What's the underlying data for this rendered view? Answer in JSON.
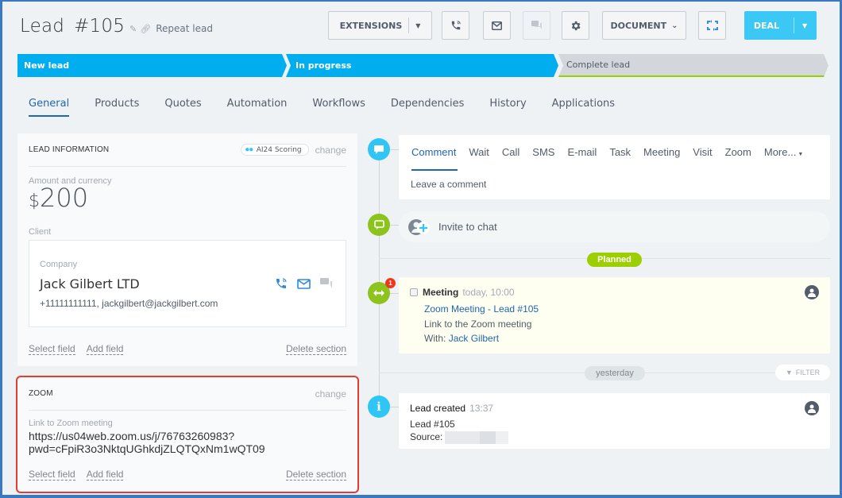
{
  "header": {
    "title": "Lead",
    "number": "#105",
    "repeat_lead": "Repeat lead"
  },
  "toolbar": {
    "extensions_label": "EXTENSIONS",
    "document_label": "DOCUMENT",
    "deal_label": "DEAL"
  },
  "stages": [
    {
      "label": "New lead",
      "state": "active"
    },
    {
      "label": "In progress",
      "state": "active"
    },
    {
      "label": "Complete lead",
      "state": "inactive"
    }
  ],
  "tabs": [
    "General",
    "Products",
    "Quotes",
    "Automation",
    "Workflows",
    "Dependencies",
    "History",
    "Applications"
  ],
  "lead_info": {
    "title": "LEAD INFORMATION",
    "scoring_label": "AI24 Scoring",
    "change_label": "change",
    "amount_label": "Amount and currency",
    "currency_symbol": "$",
    "amount": "200",
    "client_label": "Client",
    "company_label": "Company",
    "company_name": "Jack Gilbert LTD",
    "company_contact": "+11111111111, jackgilbert@jackgilbert.com",
    "select_field": "Select field",
    "add_field": "Add field",
    "delete_section": "Delete section"
  },
  "zoom_section": {
    "title": "ZOOM",
    "change_label": "change",
    "link_label": "Link to Zoom meeting",
    "link_line1": "https://us04web.zoom.us/j/76763260983?",
    "link_line2": "pwd=cFpiR3o3NktqUGhkdjZLQTQxNm1wQT09",
    "select_field": "Select field",
    "add_field": "Add field",
    "delete_section": "Delete section"
  },
  "editor": {
    "tabs": [
      "Comment",
      "Wait",
      "Call",
      "SMS",
      "E-mail",
      "Task",
      "Meeting",
      "Visit",
      "Zoom"
    ],
    "more_label": "More...",
    "placeholder": "Leave a comment"
  },
  "chat": {
    "invite_label": "Invite to chat"
  },
  "timeline": {
    "planned_label": "Planned",
    "yesterday_label": "yesterday",
    "filter_label": "FILTER",
    "meeting": {
      "badge_count": "1",
      "title": "Meeting",
      "time": "today, 10:00",
      "subject": "Zoom Meeting - Lead #105",
      "description": "Link to the Zoom meeting",
      "with_label": "With:",
      "with_name": "Jack Gilbert"
    },
    "created": {
      "title": "Lead created",
      "time": "13:37",
      "line1": "Lead #105",
      "source_label": "Source:"
    }
  },
  "colors": {
    "accent_blue": "#00aeef",
    "link_blue": "#2067b0",
    "green": "#8cc31c",
    "highlight_red": "#e53b30",
    "deal_button": "#3bc8f5"
  }
}
